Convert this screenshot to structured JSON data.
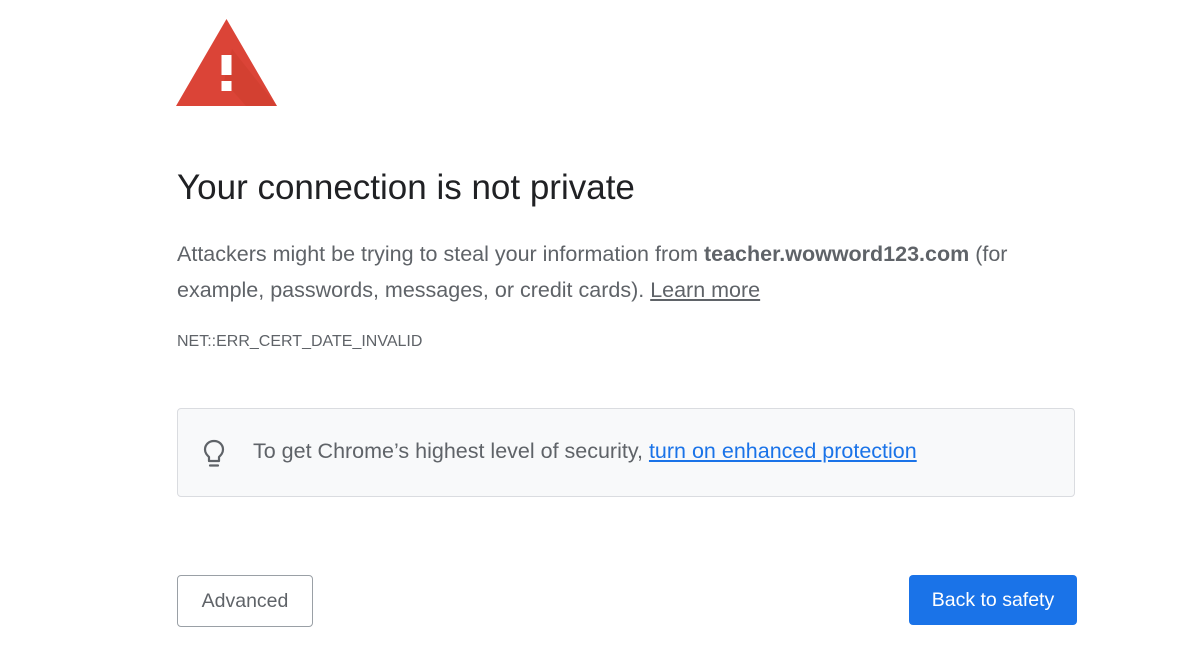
{
  "interstitial": {
    "icon": "warning-triangle-icon",
    "icon_color": "#db4437",
    "title": "Your connection is not private",
    "message": {
      "prefix": "Attackers might be trying to steal your information from ",
      "domain": "teacher.wowword123.com",
      "suffix": " (for example, passwords, messages, or credit cards). ",
      "learn_more": "Learn more"
    },
    "error_code": "NET::ERR_CERT_DATE_INVALID"
  },
  "enhanced_protection": {
    "icon": "lightbulb-icon",
    "text": "To get Chrome’s highest level of security, ",
    "link_text": "turn on enhanced protection",
    "link_color": "#1a73e8"
  },
  "buttons": {
    "advanced_label": "Advanced",
    "back_label": "Back to safety",
    "primary_color": "#1a73e8"
  }
}
